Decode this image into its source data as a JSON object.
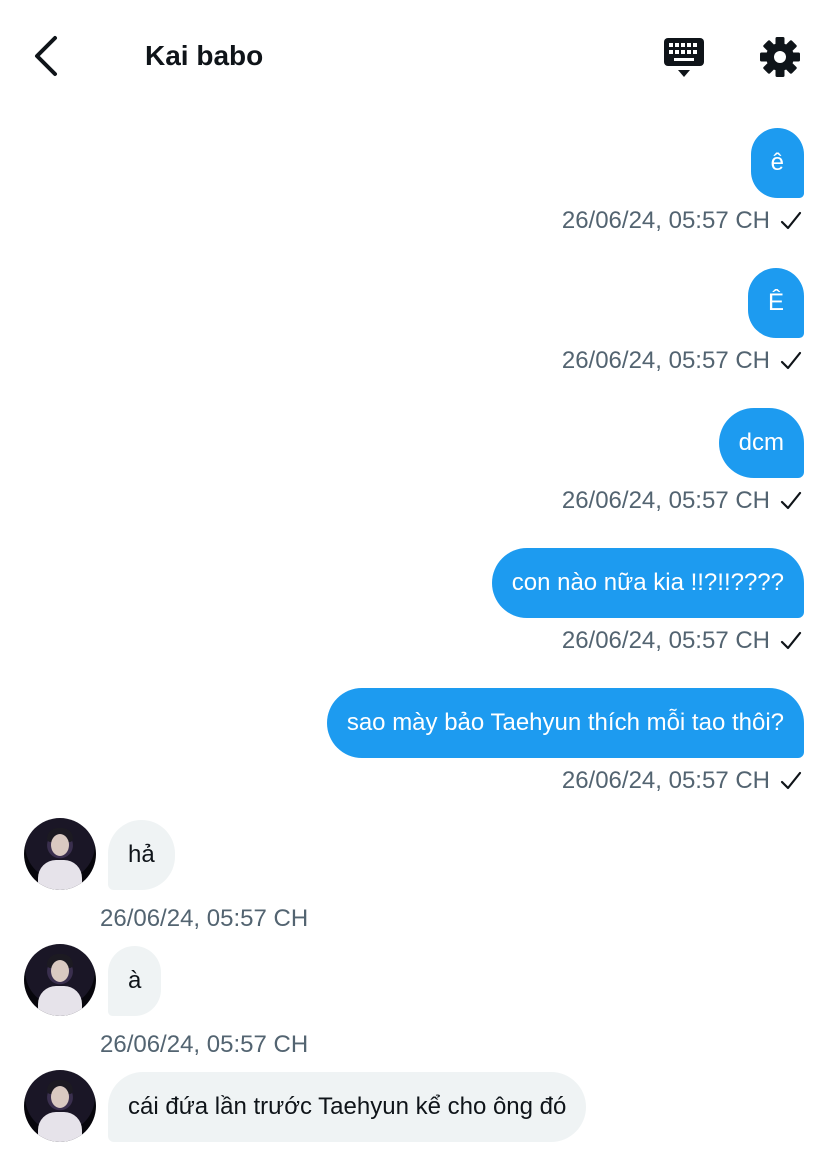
{
  "header": {
    "title": "Kai babo",
    "back_icon": "chevron-left-icon",
    "keyboard_icon": "keyboard-icon",
    "settings_icon": "gear-icon"
  },
  "colors": {
    "outgoing_bubble": "#1d9bf0",
    "incoming_bubble": "#eff3f4",
    "timestamp": "#536471"
  },
  "messages": [
    {
      "direction": "outgoing",
      "text": "ê",
      "time": "26/06/24, 05:57 CH",
      "status_icon": "check-icon"
    },
    {
      "direction": "outgoing",
      "text": "Ê",
      "time": "26/06/24, 05:57 CH",
      "status_icon": "check-icon"
    },
    {
      "direction": "outgoing",
      "text": "dcm",
      "time": "26/06/24, 05:57 CH",
      "status_icon": "check-icon"
    },
    {
      "direction": "outgoing",
      "text": "con nào nữa kia !!?!!????",
      "time": "26/06/24, 05:57 CH",
      "status_icon": "check-icon"
    },
    {
      "direction": "outgoing",
      "text": "sao mày bảo Taehyun thích mỗi tao thôi?",
      "time": "26/06/24, 05:57 CH",
      "status_icon": "check-icon"
    },
    {
      "direction": "incoming",
      "text": "hả",
      "time": "26/06/24, 05:57 CH"
    },
    {
      "direction": "incoming",
      "text": "à",
      "time": "26/06/24, 05:57 CH"
    },
    {
      "direction": "incoming",
      "text": "cái đứa lần trước Taehyun kể cho ông đó",
      "time": ""
    }
  ]
}
